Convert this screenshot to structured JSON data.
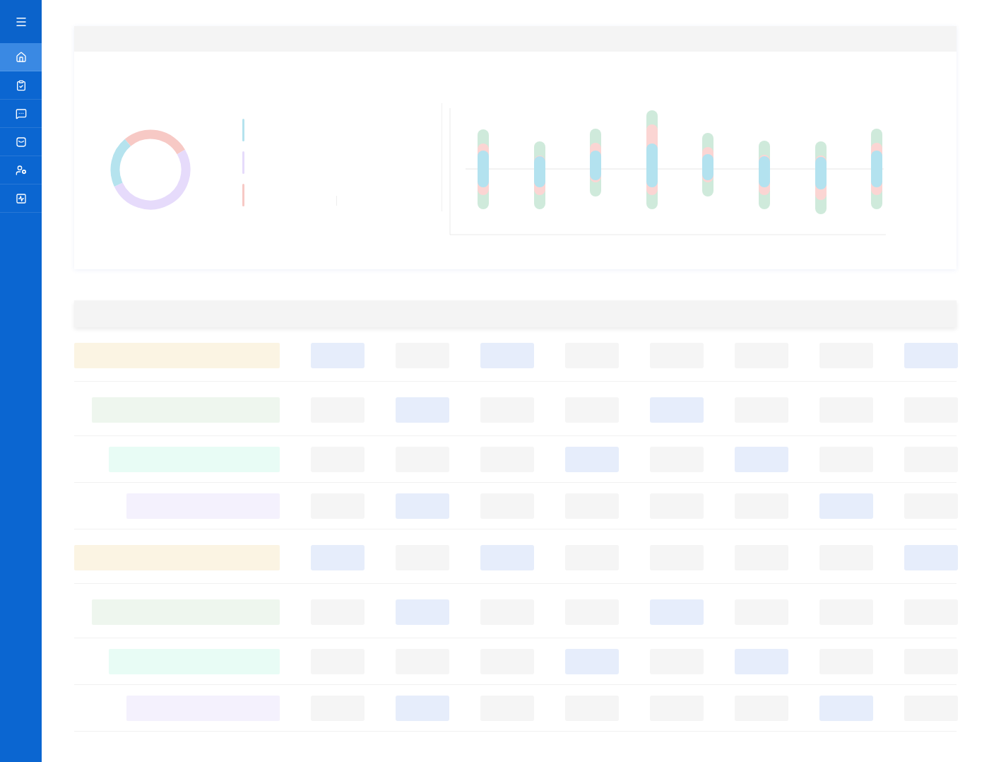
{
  "sidebar": {
    "items": [
      {
        "selected": true
      },
      {
        "selected": false
      },
      {
        "selected": false
      },
      {
        "selected": false
      },
      {
        "selected": false
      },
      {
        "selected": false
      }
    ]
  },
  "table": {
    "rows": [
      {
        "color": "#fbf4e3",
        "cells": [
          {
            "color": "#e6edfb"
          },
          {
            "color": "#f5f5f5"
          },
          {
            "color": "#e6edfb"
          },
          {
            "color": "#f5f5f5"
          },
          {
            "color": "#f5f5f5"
          },
          {
            "color": "#f5f5f5"
          },
          {
            "color": "#f5f5f5"
          },
          {
            "color": "#e6edfb"
          }
        ]
      },
      {
        "color": "#eef6ee",
        "cells": [
          {
            "color": "#f5f5f5"
          },
          {
            "color": "#e6edfb"
          },
          {
            "color": "#f5f5f5"
          },
          {
            "color": "#f5f5f5"
          },
          {
            "color": "#e6edfb"
          },
          {
            "color": "#f5f5f5"
          },
          {
            "color": "#f5f5f5"
          },
          {
            "color": "#f5f5f5"
          }
        ]
      },
      {
        "color": "#e8fcf5",
        "cells": [
          {
            "color": "#f5f5f5"
          },
          {
            "color": "#f5f5f5"
          },
          {
            "color": "#f5f5f5"
          },
          {
            "color": "#e6edfb"
          },
          {
            "color": "#f5f5f5"
          },
          {
            "color": "#e6edfb"
          },
          {
            "color": "#f5f5f5"
          },
          {
            "color": "#f5f5f5"
          }
        ]
      },
      {
        "color": "#f4f1fd",
        "cells": [
          {
            "color": "#f5f5f5"
          },
          {
            "color": "#e6edfb"
          },
          {
            "color": "#f5f5f5"
          },
          {
            "color": "#f5f5f5"
          },
          {
            "color": "#f5f5f5"
          },
          {
            "color": "#f5f5f5"
          },
          {
            "color": "#e6edfb"
          },
          {
            "color": "#f5f5f5"
          }
        ]
      },
      {
        "color": "#fbf4e3",
        "cells": [
          {
            "color": "#e6edfb"
          },
          {
            "color": "#f5f5f5"
          },
          {
            "color": "#e6edfb"
          },
          {
            "color": "#f5f5f5"
          },
          {
            "color": "#f5f5f5"
          },
          {
            "color": "#f5f5f5"
          },
          {
            "color": "#f5f5f5"
          },
          {
            "color": "#e6edfb"
          }
        ]
      },
      {
        "color": "#eef6ee",
        "cells": [
          {
            "color": "#f5f5f5"
          },
          {
            "color": "#e6edfb"
          },
          {
            "color": "#f5f5f5"
          },
          {
            "color": "#f5f5f5"
          },
          {
            "color": "#e6edfb"
          },
          {
            "color": "#f5f5f5"
          },
          {
            "color": "#f5f5f5"
          },
          {
            "color": "#f5f5f5"
          }
        ]
      },
      {
        "color": "#e8fcf5",
        "cells": [
          {
            "color": "#f5f5f5"
          },
          {
            "color": "#f5f5f5"
          },
          {
            "color": "#f5f5f5"
          },
          {
            "color": "#e6edfb"
          },
          {
            "color": "#f5f5f5"
          },
          {
            "color": "#e6edfb"
          },
          {
            "color": "#f5f5f5"
          },
          {
            "color": "#f5f5f5"
          }
        ]
      },
      {
        "color": "#f4f1fd",
        "cells": [
          {
            "color": "#f5f5f5"
          },
          {
            "color": "#e6edfb"
          },
          {
            "color": "#f5f5f5"
          },
          {
            "color": "#f5f5f5"
          },
          {
            "color": "#f5f5f5"
          },
          {
            "color": "#f5f5f5"
          },
          {
            "color": "#e6edfb"
          },
          {
            "color": "#f5f5f5"
          }
        ]
      }
    ]
  }
}
